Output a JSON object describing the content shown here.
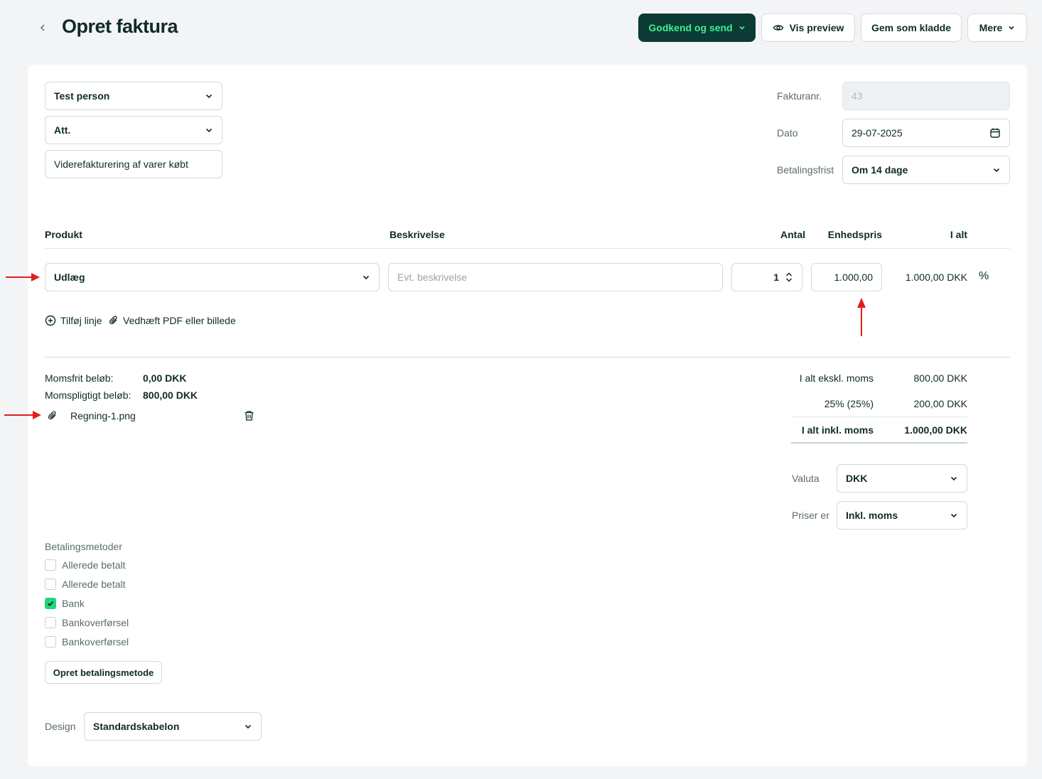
{
  "header": {
    "title": "Opret faktura",
    "back_icon": "chevron-left-icon",
    "buttons": {
      "approve_send": "Godkend og send",
      "preview": "Vis preview",
      "save_draft": "Gem som kladde",
      "more": "Mere"
    }
  },
  "customer": {
    "contact": "Test person",
    "att": "Att.",
    "subject": "Viderefakturering af varer købt"
  },
  "meta": {
    "invoice_no_label": "Fakturanr.",
    "invoice_no": "43",
    "date_label": "Dato",
    "date": "29-07-2025",
    "due_label": "Betalingsfrist",
    "due": "Om 14 dage"
  },
  "lines": {
    "headers": {
      "product": "Produkt",
      "description": "Beskrivelse",
      "qty": "Antal",
      "unit_price": "Enhedspris",
      "total": "I alt"
    },
    "rows": [
      {
        "product": "Udlæg",
        "description_placeholder": "Evt. beskrivelse",
        "qty": "1",
        "unit_price": "1.000,00",
        "total": "1.000,00 DKK",
        "discount_symbol": "%"
      }
    ],
    "add_line": "Tilføj linje",
    "attach": "Vedhæft PDF eller billede"
  },
  "vat_summary": {
    "exempt_label": "Momsfrit beløb:",
    "exempt_value": "0,00 DKK",
    "taxable_label": "Momspligtigt beløb:",
    "taxable_value": "800,00 DKK"
  },
  "attachment": {
    "filename": "Regning-1.png"
  },
  "totals": {
    "excl_label": "I alt ekskl. moms",
    "excl_value": "800,00 DKK",
    "vat_label": "25% (25%)",
    "vat_value": "200,00 DKK",
    "incl_label": "I alt inkl. moms",
    "incl_value": "1.000,00 DKK"
  },
  "options": {
    "currency_label": "Valuta",
    "currency": "DKK",
    "prices_label": "Priser er",
    "prices": "Inkl. moms"
  },
  "payment": {
    "title": "Betalingsmetoder",
    "methods": [
      {
        "label": "Allerede betalt",
        "checked": false
      },
      {
        "label": "Allerede betalt",
        "checked": false
      },
      {
        "label": "Bank",
        "checked": true
      },
      {
        "label": "Bankoverførsel",
        "checked": false
      },
      {
        "label": "Bankoverførsel",
        "checked": false
      }
    ],
    "create_button": "Opret betalingsmetode"
  },
  "design": {
    "label": "Design",
    "value": "Standardskabelon"
  },
  "colors": {
    "primary_button_bg": "#0b3b34",
    "primary_button_text": "#3ff08f",
    "checkbox_checked": "#22d67a",
    "annotation_arrow": "#e02020"
  }
}
